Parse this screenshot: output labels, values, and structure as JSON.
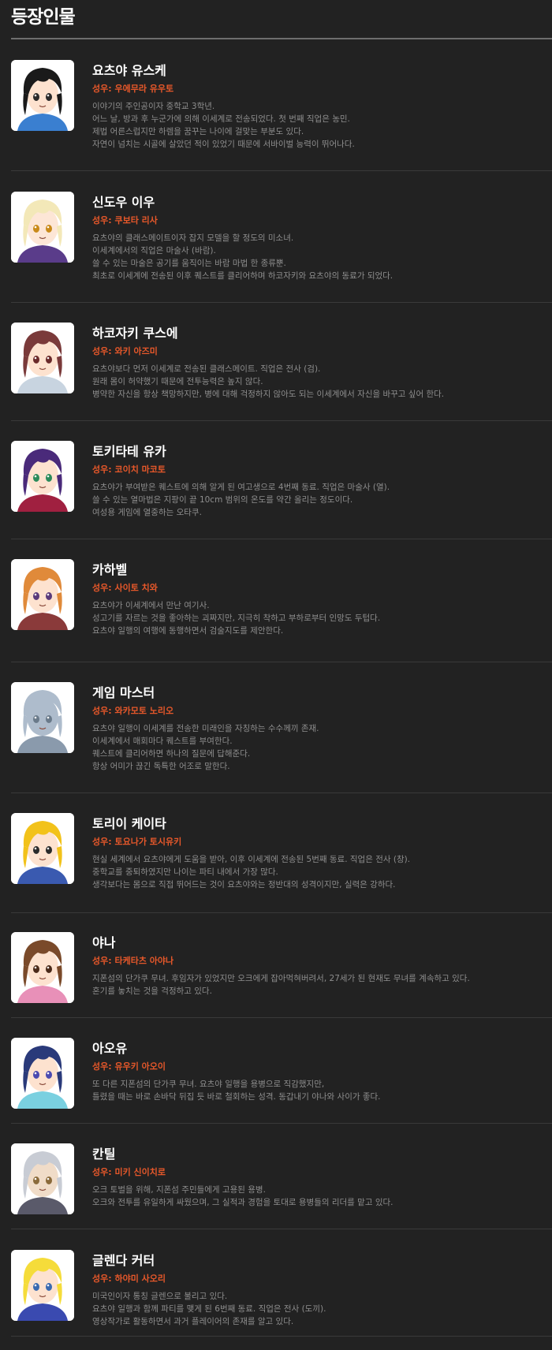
{
  "page": {
    "title": "등장인물"
  },
  "characters": [
    {
      "id": "yoshiya",
      "name": "요츠야 유스케",
      "va": "성우: 우에무라 유우토",
      "lines": [
        "이야기의 주인공이자 중학교 3학년.",
        "어느 날, 방과 후 누군가에 의해 이세계로 전송되었다. 첫 번째 직업은 농민.",
        "제법 어른스럽지만 하렘을 꿈꾸는 나이에 걸맞는 부분도 있다.",
        "자연이 넘치는 시골에 살았던 적이 있었기 때문에 서바이벌 능력이 뛰어나다."
      ],
      "portrait": {
        "skin": "#fde2cf",
        "hair": "#1a1a1a",
        "cloth": "#3a7fd0",
        "bg": "#ffffff",
        "eye": "#2a2a2a"
      }
    },
    {
      "id": "shindou",
      "name": "신도우 이우",
      "va": "성우: 쿠보타 리사",
      "lines": [
        "요츠야의 클래스메이트이자 잡지 모델을 할 정도의 미소녀.",
        "이세계에서의 직업은 마술사 (바람).",
        "쓸 수 있는 마술은 공기를 움직이는 바람 마법 한 종류뿐.",
        "최초로 이세계에 전송된 이후 퀘스트를 클리어하며 하코자키와 요츠야의 동료가 되었다."
      ],
      "portrait": {
        "skin": "#fde6d6",
        "hair": "#f3e8b8",
        "cloth": "#5a3c8a",
        "bg": "#ffffff",
        "eye": "#c98a1a"
      }
    },
    {
      "id": "hakozaki",
      "name": "하코자키 쿠스에",
      "va": "성우: 와키 아즈미",
      "lines": [
        "요츠야보다 먼저 이세계로 전송된 클래스메이트. 직업은 전사 (검).",
        "원래 몸이 허약했기 때문에 전투능력은 높지 않다.",
        "병약한 자신을 항상 책망하지만, 병에 대해 걱정하지 않아도 되는 이세계에서 자신을 바꾸고 싶어 한다."
      ],
      "portrait": {
        "skin": "#fde2cf",
        "hair": "#7a3a3a",
        "cloth": "#c8d4e0",
        "bg": "#ffffff",
        "eye": "#6a2a2a"
      }
    },
    {
      "id": "tokitate",
      "name": "토키타테 유카",
      "va": "성우: 코이치 마코토",
      "lines": [
        "요츠야가 부여받은 퀘스트에 의해 알게 된 여고생으로 4번째 동료. 직업은 마술사 (열).",
        "쓸 수 있는 열마법은 지팡이 끝 10cm 범위의 온도를 약간 올리는 정도이다.",
        "여성용 게임에 열중하는 오타쿠."
      ],
      "portrait": {
        "skin": "#fde2cf",
        "hair": "#4a2a7a",
        "cloth": "#a02040",
        "bg": "#ffffff",
        "eye": "#2a8a5a"
      }
    },
    {
      "id": "kahabel",
      "name": "카하벨",
      "va": "성우: 사이토 치와",
      "lines": [
        "요츠야가 이세계에서 만난 여기사.",
        "성고기를 자르는 것을 좋아하는 괴짜지만, 지극히 착하고 부하로부터 인망도 두텁다.",
        "요츠야 일행의 여행에 동행하면서 검술지도를 제안한다."
      ],
      "portrait": {
        "skin": "#fde2cf",
        "hair": "#e08a3a",
        "cloth": "#8a3a3a",
        "bg": "#ffffff",
        "eye": "#5a3a7a"
      }
    },
    {
      "id": "gamemaster",
      "name": "게임 마스터",
      "va": "성우: 와카모토 노리오",
      "lines": [
        "요츠야 일행이 이세계를 전송한 미래인을 자칭하는 수수께끼 존재.",
        "이세계에서 매회마다 퀘스트를 부여한다.",
        "퀘스트에 클리어하면 하나의 질문에 답해준다.",
        "항상 어미가 끊긴 독특한 어조로 말한다."
      ],
      "portrait": {
        "skin": "#aebccc",
        "hair": "#aebccc",
        "cloth": "#8a9aac",
        "bg": "#ffffff",
        "eye": "#6a7a8a"
      }
    },
    {
      "id": "torii",
      "name": "토리이 케이타",
      "va": "성우: 토요나가 토시유키",
      "lines": [
        "현실 세계에서 요츠야에게 도움을 받아, 이후 이세계에 전송된 5번째 동료. 직업은 전사 (창).",
        "중학교를 중퇴하였지만 나이는 파티 내에서 가장 많다.",
        "생각보다는 몸으로 직접 뛰어드는 것이 요츠야와는 정반대의 성격이지만, 실력은 강하다."
      ],
      "portrait": {
        "skin": "#fde2cf",
        "hair": "#f2c21a",
        "cloth": "#3a5ab0",
        "bg": "#ffffff",
        "eye": "#2a2a2a"
      }
    },
    {
      "id": "yana",
      "name": "야나",
      "va": "성우: 타케타츠 아야나",
      "lines": [
        "지폰섬의 단가쿠 무녀. 후임자가 있었지만 오크에게 잡아먹혀버려서, 27세가 된 현재도 무녀를 계속하고 있다.",
        "혼기를 놓치는 것을 걱정하고 있다."
      ],
      "portrait": {
        "skin": "#fde2cf",
        "hair": "#7a4a2a",
        "cloth": "#e890b8",
        "bg": "#ffffff",
        "eye": "#4a2a1a"
      }
    },
    {
      "id": "aoyu",
      "name": "아오유",
      "va": "성우: 유우키 아오이",
      "lines": [
        "또 다른 지폰섬의 단가쿠 무녀. 요츠야 일행을 용병으로 직감했지만,",
        "틀렸을 때는 바로 손바닥 뒤집 듯 바로 철회하는 성격. 동갑내기 야나와 사이가 좋다."
      ],
      "portrait": {
        "skin": "#fde2cf",
        "hair": "#2a3a7a",
        "cloth": "#7ad0e0",
        "bg": "#ffffff",
        "eye": "#4a4ab0"
      }
    },
    {
      "id": "kantil",
      "name": "칸틸",
      "va": "성우: 미키 신이치로",
      "lines": [
        "오크 토벌을 위해, 지폰섬 주민들에게 고용된 용병.",
        "오크와 전투를 유일하게 싸웠으며, 그 실적과 경험을 토대로 용병들의 리더를 맡고 있다."
      ],
      "portrait": {
        "skin": "#f0dcc8",
        "hair": "#c8ccd4",
        "cloth": "#5a5a6a",
        "bg": "#ffffff",
        "eye": "#8a6a3a"
      }
    },
    {
      "id": "glenda",
      "name": "글렌다 커터",
      "va": "성우: 하야미 사오리",
      "lines": [
        "미국인이자 통칭 글렌으로 불리고 있다.",
        "요츠야 일행과 함께 파티를 맺게 된 6번째 동료. 직업은 전사 (도끼).",
        "영상작가로 활동하면서 과거 플레이어의 존재를 알고 있다."
      ],
      "portrait": {
        "skin": "#fde2cf",
        "hair": "#f5dc3a",
        "cloth": "#3a4ab0",
        "bg": "#ffffff",
        "eye": "#3a6ab0"
      }
    }
  ]
}
